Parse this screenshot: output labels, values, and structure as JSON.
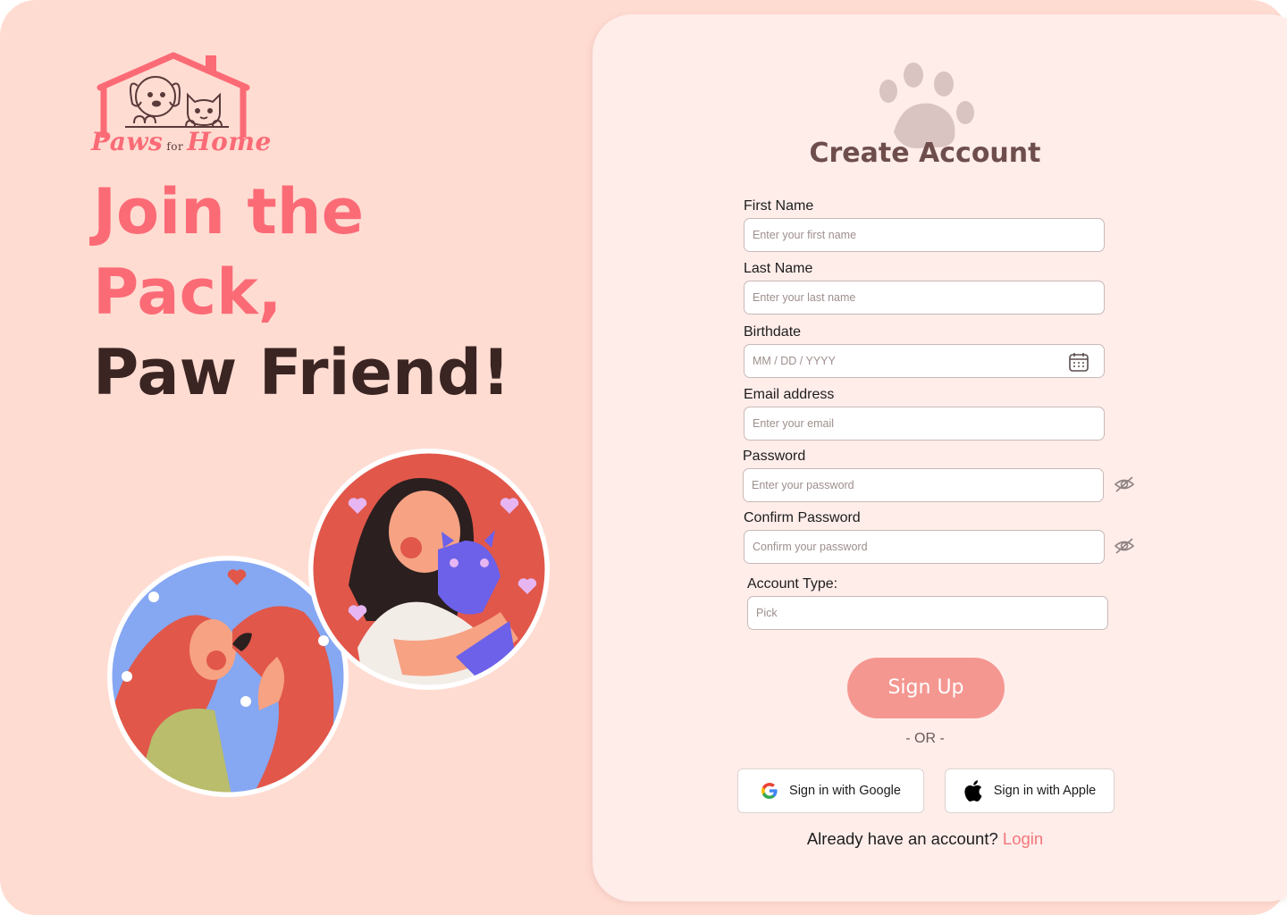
{
  "brand": {
    "logo_words": [
      "Paws",
      "for",
      "Home"
    ]
  },
  "headline": {
    "line1": "Join the",
    "line2": "Pack,",
    "line3": "Paw Friend!"
  },
  "form": {
    "title": "Create Account",
    "first_name": {
      "label": "First Name",
      "placeholder": "Enter your first name"
    },
    "last_name": {
      "label": "Last Name",
      "placeholder": "Enter your last name"
    },
    "birthdate": {
      "label": "Birthdate",
      "placeholder": "MM / DD / YYYY",
      "icon": "calendar-icon"
    },
    "email": {
      "label": "Email address",
      "placeholder": "Enter your email"
    },
    "password": {
      "label": "Password",
      "placeholder": "Enter your password",
      "icon": "eye-off-icon"
    },
    "confirm_password": {
      "label": "Confirm Password",
      "placeholder": "Confirm your password",
      "icon": "eye-off-icon"
    },
    "account_type": {
      "label": "Account Type:",
      "placeholder": "Pick"
    },
    "submit_label": "Sign Up",
    "divider": "-  OR -",
    "google_label": "Sign in with Google",
    "apple_label": "Sign in with Apple",
    "already_text": "Already have an account?",
    "login_link": "Login"
  },
  "colors": {
    "page_bg": "#ffdcd2",
    "card_bg": "#ffedea",
    "accent_pink": "#fb6b76",
    "button_pink": "#f59791",
    "headline_dark": "#3b2523",
    "link": "#f3767a"
  }
}
